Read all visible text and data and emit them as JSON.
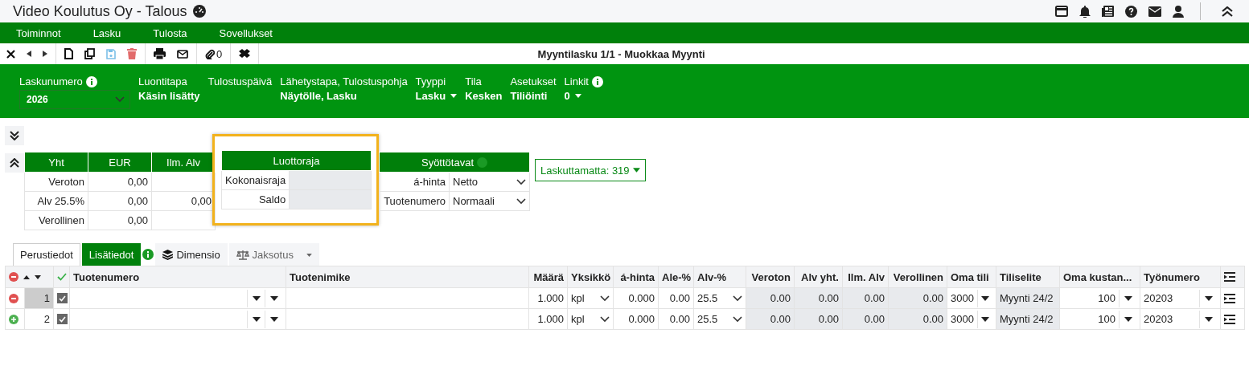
{
  "app": {
    "title": "Video Koulutus Oy - Talous"
  },
  "menu": [
    "Toiminnot",
    "Lasku",
    "Tulosta",
    "Sovellukset"
  ],
  "toolbar": {
    "attachment_count": "0",
    "document_title": "Myyntilasku 1/1 - Muokkaa Myynti"
  },
  "header_fields": [
    {
      "kind": "select",
      "label": "Laskunumero",
      "info": true,
      "value": "2026"
    },
    {
      "kind": "text",
      "label": "Luontitapa",
      "info": false,
      "value": "Käsin lisätty"
    },
    {
      "kind": "text",
      "label": "Tulostuspäivä",
      "info": false
    },
    {
      "kind": "text",
      "label": "Lähetystapa, Tulostuspohja",
      "info": false,
      "value": "Näytölle, Lasku"
    },
    {
      "kind": "dropdown",
      "label": "Tyyppi",
      "info": false,
      "value": "Lasku"
    },
    {
      "kind": "text",
      "label": "Tila",
      "info": false,
      "value": "Kesken"
    },
    {
      "kind": "text",
      "label": "Asetukset",
      "info": false,
      "value": "Tiliöinti"
    },
    {
      "kind": "dropdown",
      "label": "Linkit",
      "info": true,
      "value": "0"
    }
  ],
  "totals": {
    "columns": [
      "Yht",
      "EUR",
      "Ilm. Alv"
    ],
    "rows": [
      {
        "label": "Veroton",
        "eur": "0,00"
      },
      {
        "label": "Alv 25.5%",
        "eur": "0,00",
        "vat": "0,00"
      },
      {
        "label": "Verollinen",
        "eur": "0,00"
      }
    ]
  },
  "credit_limit": {
    "title": "Luottoraja",
    "rows": [
      {
        "label": "Kokonaisraja"
      },
      {
        "label": "Saldo"
      }
    ]
  },
  "input_modes": {
    "title": "Syöttötavat",
    "rows": [
      {
        "label": "á-hinta",
        "value": "Netto"
      },
      {
        "label": "Tuotenumero",
        "value": "Normaali"
      }
    ]
  },
  "unbilled_button": "Laskuttamatta: 319",
  "tabs": [
    {
      "kind": "plain",
      "label": "Perustiedot",
      "selected": true,
      "info": false
    },
    {
      "kind": "highlight",
      "label": "Lisätiedot",
      "selected": false,
      "info": true
    },
    {
      "kind": "layers",
      "label": "Dimensio",
      "selected": false,
      "info": false
    },
    {
      "kind": "scale",
      "label": "Jaksotus",
      "selected": false,
      "info": false
    }
  ],
  "grid": {
    "columns": [
      {
        "kind": "product",
        "label": "Tuotenumero"
      },
      {
        "kind": "text",
        "label": "Tuotenimike"
      },
      {
        "kind": "number",
        "label": "Määrä"
      },
      {
        "kind": "select",
        "label": "Yksikkö"
      },
      {
        "kind": "number",
        "label": "á-hinta"
      },
      {
        "kind": "number",
        "label": "Ale-%"
      },
      {
        "kind": "select",
        "label": "Alv-%"
      },
      {
        "kind": "readonly",
        "label": "Veroton"
      },
      {
        "kind": "readonly",
        "label": "Alv yht."
      },
      {
        "kind": "readonly",
        "label": "Ilm. Alv"
      },
      {
        "kind": "readonly",
        "label": "Verollinen"
      },
      {
        "kind": "dropdown",
        "label": "Oma tili"
      },
      {
        "kind": "readonly-text",
        "label": "Tiliselite"
      },
      {
        "kind": "dropdown-right",
        "label": "Oma kustan..."
      },
      {
        "kind": "dropdown",
        "label": "Työnumero"
      }
    ],
    "rows": [
      {
        "selected": true,
        "kind": "remove",
        "number": "1",
        "checked": true,
        "cells": [
          {},
          {},
          {
            "value": "1.000"
          },
          {
            "value": "kpl"
          },
          {
            "value": "0.000"
          },
          {
            "value": "0.00"
          },
          {
            "value": "25.5"
          },
          {
            "value": "0.00"
          },
          {
            "value": "0.00"
          },
          {
            "value": "0.00"
          },
          {
            "value": "0.00"
          },
          {
            "value": "3000"
          },
          {
            "value": "Myynti 24/2"
          },
          {
            "value": "100"
          },
          {
            "value": "20203"
          }
        ]
      },
      {
        "selected": false,
        "kind": "add",
        "number": "2",
        "checked": true,
        "cells": [
          {},
          {},
          {
            "value": "1.000"
          },
          {
            "value": "kpl"
          },
          {
            "value": "0.000"
          },
          {
            "value": "0.00"
          },
          {
            "value": "25.5"
          },
          {
            "value": "0.00"
          },
          {
            "value": "0.00"
          },
          {
            "value": "0.00"
          },
          {
            "value": "0.00"
          },
          {
            "value": "3000"
          },
          {
            "value": "Myynti 24/2"
          },
          {
            "value": "100"
          },
          {
            "value": "20203"
          }
        ]
      }
    ]
  }
}
